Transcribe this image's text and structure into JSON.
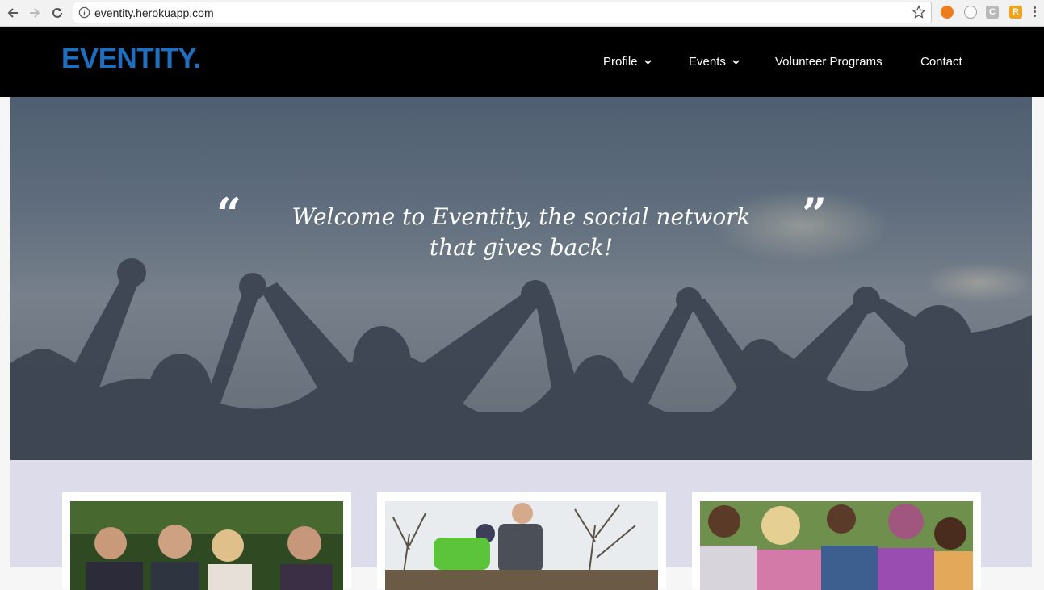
{
  "browser": {
    "url": "eventity.herokuapp.com",
    "extensions": {
      "ext3": "C",
      "ext4": "R"
    }
  },
  "site": {
    "logo": "EVENTITY.",
    "brand_color": "#1f6fc0",
    "nav": [
      {
        "label": "Profile",
        "has_dropdown": true
      },
      {
        "label": "Events",
        "has_dropdown": true
      },
      {
        "label": "Volunteer Programs",
        "has_dropdown": false
      },
      {
        "label": "Contact",
        "has_dropdown": false
      }
    ]
  },
  "hero": {
    "quote_open": "“",
    "quote_close": "”",
    "text": "Welcome to Eventity, the social network that gives back!"
  },
  "cards": [
    {
      "image": "group-of-volunteers-photo"
    },
    {
      "image": "planting-trees-photo"
    },
    {
      "image": "children-group-photo"
    }
  ]
}
